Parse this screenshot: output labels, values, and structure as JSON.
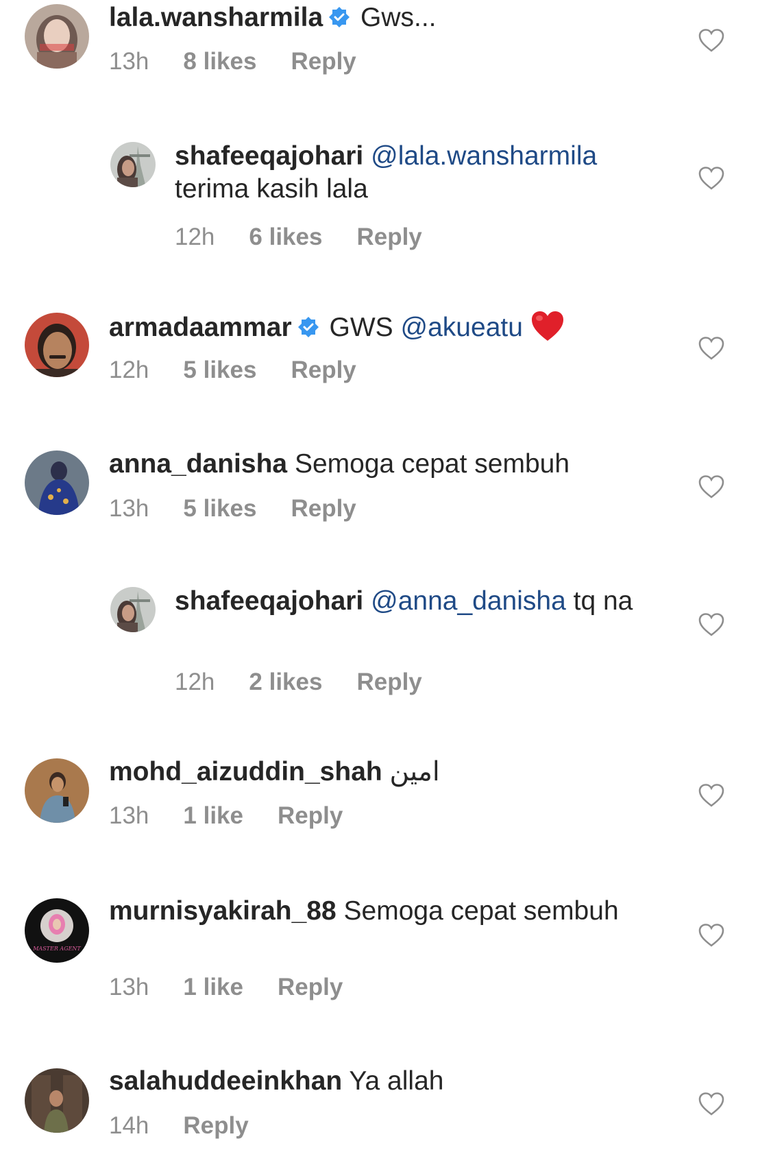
{
  "comments": [
    {
      "username": "lala.wansharmila",
      "verified": true,
      "mention": "",
      "text": "Gws...",
      "time": "13h",
      "likes": "8 likes",
      "reply": "Reply",
      "is_reply": false,
      "avatar": "avatar-woman-hijab"
    },
    {
      "username": "shafeeqajohari",
      "verified": false,
      "mention": "@lala.wansharmila",
      "text": "terima kasih lala",
      "time": "12h",
      "likes": "6 likes",
      "reply": "Reply",
      "is_reply": true,
      "avatar": "avatar-woman-tower"
    },
    {
      "username": "armadaammar",
      "verified": true,
      "mention": "@akueatu",
      "text_before": "GWS",
      "text": "",
      "emoji": "red-heart",
      "time": "12h",
      "likes": "5 likes",
      "reply": "Reply",
      "is_reply": false,
      "avatar": "avatar-man-mustache"
    },
    {
      "username": "anna_danisha",
      "verified": false,
      "mention": "",
      "text": "Semoga cepat sembuh",
      "time": "13h",
      "likes": "5 likes",
      "reply": "Reply",
      "is_reply": false,
      "avatar": "avatar-woman-blue-dress"
    },
    {
      "username": "shafeeqajohari",
      "verified": false,
      "mention": "@anna_danisha",
      "text": "tq na",
      "time": "12h",
      "likes": "2 likes",
      "reply": "Reply",
      "is_reply": true,
      "avatar": "avatar-woman-tower"
    },
    {
      "username": "mohd_aizuddin_shah",
      "verified": false,
      "mention": "",
      "text": "امين",
      "time": "13h",
      "likes": "1 like",
      "reply": "Reply",
      "is_reply": false,
      "avatar": "avatar-man-phone"
    },
    {
      "username": "murnisyakirah_88",
      "verified": false,
      "mention": "",
      "text": "Semoga cepat sembuh",
      "time": "13h",
      "likes": "1 like",
      "reply": "Reply",
      "is_reply": false,
      "avatar": "avatar-master-agent"
    },
    {
      "username": "salahuddeeinkhan",
      "verified": false,
      "mention": "",
      "text": "Ya allah",
      "time": "14h",
      "likes": "",
      "reply": "Reply",
      "is_reply": false,
      "avatar": "avatar-man-doorway"
    }
  ],
  "colors": {
    "verified_badge": "#3897f0",
    "mention": "#1f4a86",
    "meta": "#8e8e8e",
    "text": "#262626",
    "heart_outline": "#8e8e8e",
    "emoji_heart": "#e0202a"
  },
  "avatar_master_agent_text": "MASTER AGENT"
}
